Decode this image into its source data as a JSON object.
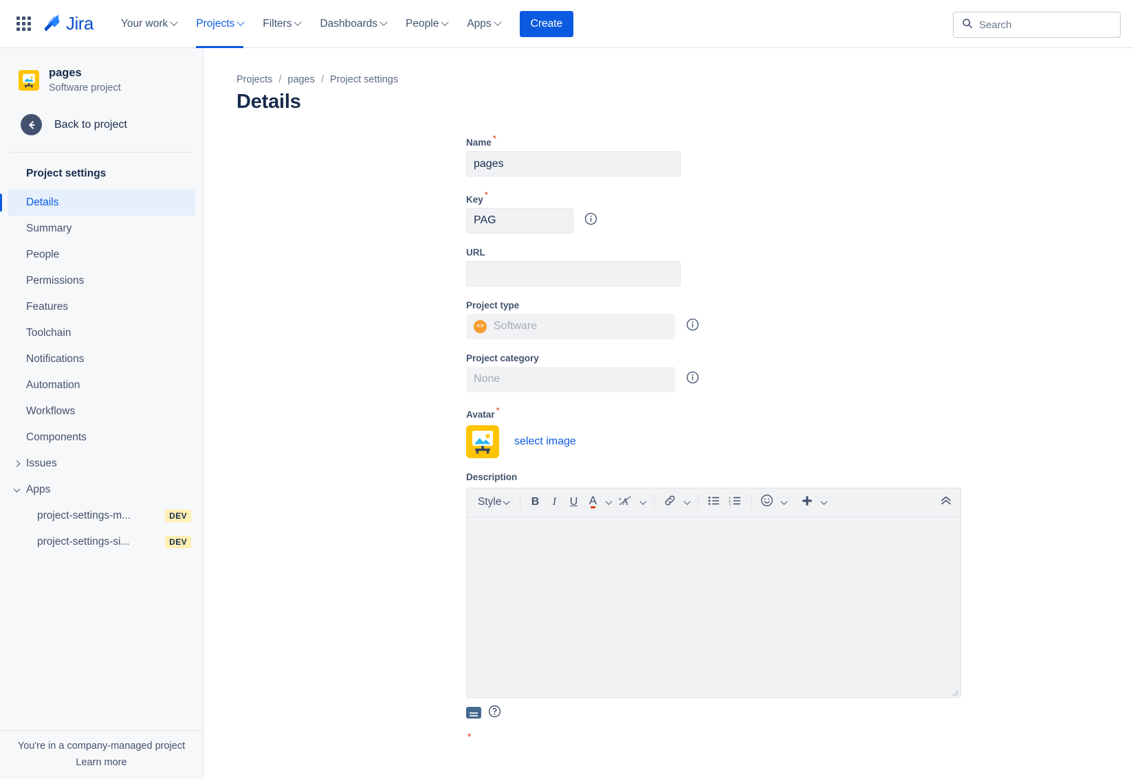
{
  "topnav": {
    "app_switcher_icon": "grid-apps-icon",
    "brand": "Jira",
    "brand_icon": "jira-logo-icon",
    "items": [
      {
        "label": "Your work",
        "has_chevron": true,
        "active": false
      },
      {
        "label": "Projects",
        "has_chevron": true,
        "active": true
      },
      {
        "label": "Filters",
        "has_chevron": true,
        "active": false
      },
      {
        "label": "Dashboards",
        "has_chevron": true,
        "active": false
      },
      {
        "label": "People",
        "has_chevron": true,
        "active": false
      },
      {
        "label": "Apps",
        "has_chevron": true,
        "active": false
      }
    ],
    "create_label": "Create",
    "search_placeholder": "Search",
    "search_value": "",
    "search_icon": "search-icon",
    "accent_color": "#0c5ae0"
  },
  "sidebar": {
    "project_name": "pages",
    "project_subtitle": "Software project",
    "project_avatar_icon": "picture-easel-icon",
    "back_label": "Back to project",
    "back_icon": "arrow-left-icon",
    "section_title": "Project settings",
    "items": [
      {
        "label": "Details",
        "selected": true,
        "type": "leaf"
      },
      {
        "label": "Summary",
        "selected": false,
        "type": "leaf"
      },
      {
        "label": "People",
        "selected": false,
        "type": "leaf"
      },
      {
        "label": "Permissions",
        "selected": false,
        "type": "leaf"
      },
      {
        "label": "Features",
        "selected": false,
        "type": "leaf"
      },
      {
        "label": "Toolchain",
        "selected": false,
        "type": "leaf"
      },
      {
        "label": "Notifications",
        "selected": false,
        "type": "leaf"
      },
      {
        "label": "Automation",
        "selected": false,
        "type": "leaf"
      },
      {
        "label": "Workflows",
        "selected": false,
        "type": "leaf"
      },
      {
        "label": "Components",
        "selected": false,
        "type": "leaf"
      },
      {
        "label": "Issues",
        "selected": false,
        "type": "group",
        "expanded": false
      },
      {
        "label": "Apps",
        "selected": false,
        "type": "group",
        "expanded": true
      }
    ],
    "apps": [
      {
        "label": "project-settings-m...",
        "badge": "DEV"
      },
      {
        "label": "project-settings-si...",
        "badge": "DEV"
      }
    ],
    "footer_text": "You're in a company-managed project",
    "footer_link": "Learn more"
  },
  "breadcrumb": {
    "items": [
      "Projects",
      "pages",
      "Project settings"
    ],
    "separator": "/"
  },
  "page": {
    "title": "Details"
  },
  "form": {
    "name": {
      "label": "Name",
      "required": true,
      "value": "pages"
    },
    "key": {
      "label": "Key",
      "required": true,
      "value": "PAG",
      "info_icon": "info-icon"
    },
    "url": {
      "label": "URL",
      "required": false,
      "value": "",
      "placeholder": ""
    },
    "project_type": {
      "label": "Project type",
      "required": false,
      "value": "Software",
      "disabled": true,
      "type_icon": "code-brackets-icon",
      "type_icon_color": "#f79b2b",
      "info_icon": "info-icon"
    },
    "project_category": {
      "label": "Project category",
      "required": false,
      "value": "None",
      "disabled": true,
      "info_icon": "info-icon"
    },
    "avatar": {
      "label": "Avatar",
      "required": true,
      "avatar_icon": "picture-easel-icon",
      "select_label": "select image"
    },
    "description": {
      "label": "Description",
      "value": "",
      "toolbar": {
        "style_label": "Style",
        "buttons": [
          {
            "name": "style-dropdown",
            "glyph": "Style",
            "chevron": true
          },
          {
            "name": "bold-button",
            "glyph": "B",
            "chevron": false
          },
          {
            "name": "italic-button",
            "glyph": "I",
            "chevron": false
          },
          {
            "name": "underline-button",
            "glyph": "U",
            "chevron": false
          },
          {
            "name": "text-color-button",
            "glyph": "A",
            "chevron": true
          },
          {
            "name": "more-formatting-button",
            "glyph": "ᵃA",
            "chevron": true
          },
          {
            "name": "link-button",
            "glyph": "link",
            "chevron": true
          },
          {
            "name": "bullet-list-button",
            "glyph": "bullets",
            "chevron": false
          },
          {
            "name": "numbered-list-button",
            "glyph": "numbers",
            "chevron": false
          },
          {
            "name": "emoji-button",
            "glyph": "emoji",
            "chevron": true
          },
          {
            "name": "insert-more-button",
            "glyph": "plus",
            "chevron": true
          },
          {
            "name": "collapse-toolbar-button",
            "glyph": "chevrons-up",
            "chevron": false
          }
        ],
        "text_color_underline": "#de350b"
      },
      "footer_icons": [
        {
          "name": "markdown-badge-icon"
        },
        {
          "name": "help-circle-icon"
        }
      ]
    }
  }
}
